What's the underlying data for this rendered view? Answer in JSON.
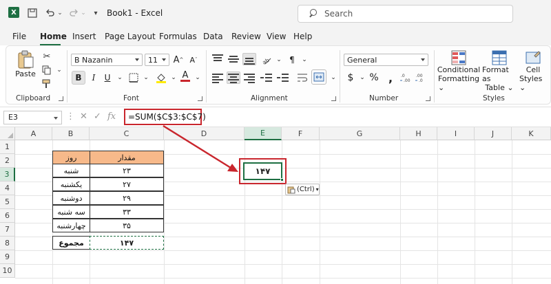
{
  "titlebar": {
    "title": "Book1 - Excel",
    "search_placeholder": "Search",
    "logo_letter": "X"
  },
  "menu": {
    "tabs": [
      "File",
      "Home",
      "Insert",
      "Page Layout",
      "Formulas",
      "Data",
      "Review",
      "View",
      "Help"
    ],
    "active": "Home"
  },
  "ribbon": {
    "clipboard": {
      "label": "Clipboard",
      "paste": "Paste"
    },
    "font": {
      "label": "Font",
      "name": "B Nazanin",
      "size": "11"
    },
    "alignment": {
      "label": "Alignment"
    },
    "number": {
      "label": "Number",
      "format": "General"
    },
    "styles": {
      "label": "Styles",
      "conditional": [
        "Conditional",
        "Formatting"
      ],
      "format_table": [
        "Format as",
        "Table"
      ],
      "cell_styles": [
        "Cell",
        "Styles"
      ]
    }
  },
  "formula_bar": {
    "name_box": "E3",
    "formula": "=SUM($C$3:$C$7)"
  },
  "grid": {
    "columns": [
      "A",
      "B",
      "C",
      "D",
      "E",
      "F",
      "G",
      "H",
      "I",
      "J",
      "K"
    ],
    "rows": [
      "1",
      "2",
      "3",
      "4",
      "5",
      "6",
      "7",
      "8",
      "9",
      "10"
    ],
    "selected_column": "E",
    "selected_row": "3"
  },
  "table": {
    "header_day": "روز",
    "header_amount": "مقدار",
    "rows": [
      {
        "day": "شنبه",
        "amount": "۲۳"
      },
      {
        "day": "یکشنبه",
        "amount": "۲۷"
      },
      {
        "day": "دوشنبه",
        "amount": "۲۹"
      },
      {
        "day": "سه شنبه",
        "amount": "۳۳"
      },
      {
        "day": "چهارشنبه",
        "amount": "۳۵"
      }
    ],
    "total_label": "مجموع",
    "total_value": "۱۴۷"
  },
  "result_cell": "۱۴۷",
  "paste_options": "(Ctrl)",
  "colors": {
    "accent": "#1d6f42",
    "highlight": "#c9262d",
    "table_header": "#f7b98a"
  }
}
